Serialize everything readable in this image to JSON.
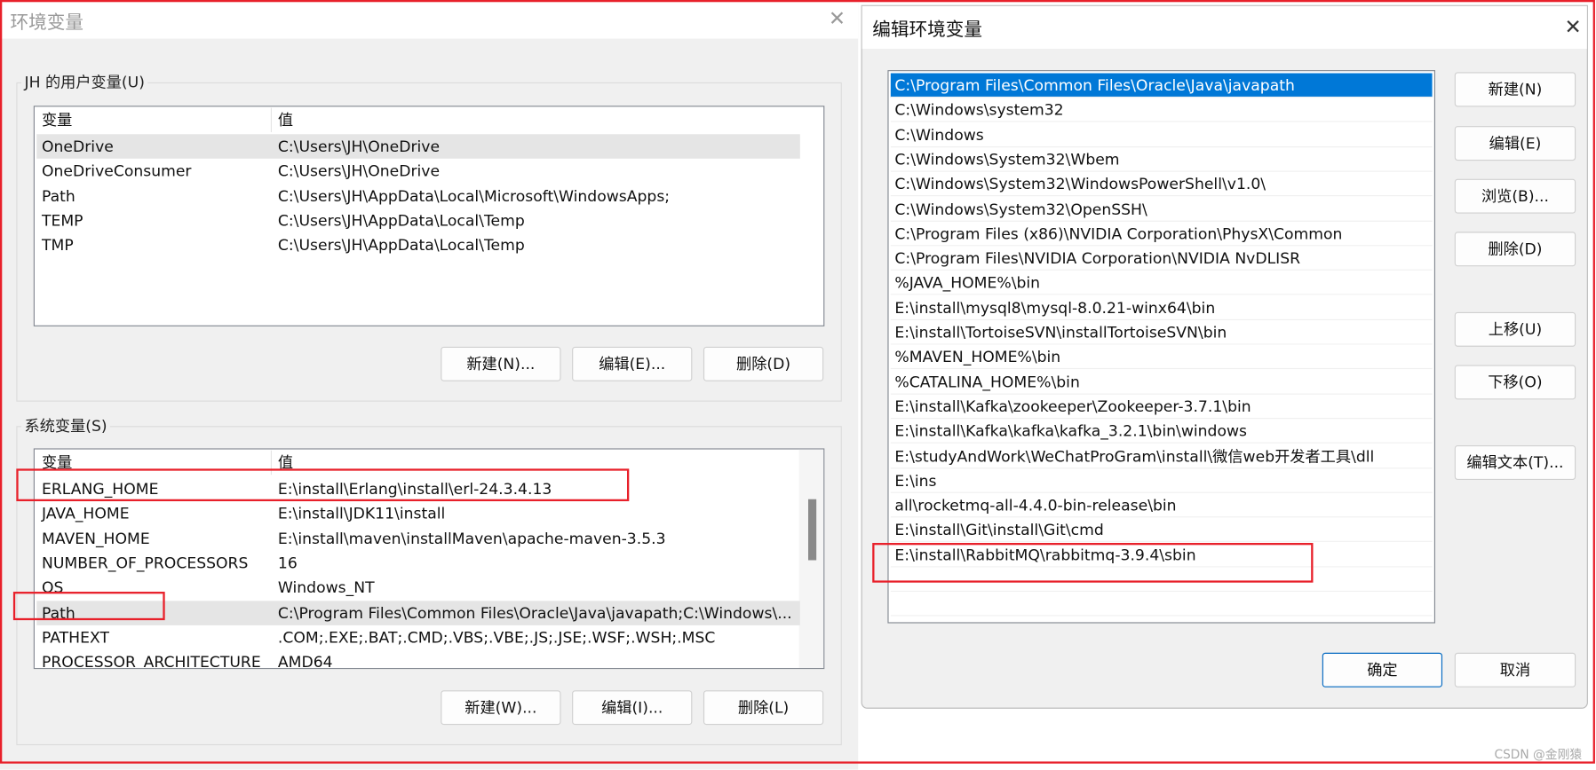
{
  "env_dialog": {
    "title": "环境变量",
    "user_group": {
      "label": "JH 的用户变量(U)",
      "headers": [
        "变量",
        "值"
      ],
      "rows": [
        [
          "OneDrive",
          "C:\\Users\\JH\\OneDrive"
        ],
        [
          "OneDriveConsumer",
          "C:\\Users\\JH\\OneDrive"
        ],
        [
          "Path",
          "C:\\Users\\JH\\AppData\\Local\\Microsoft\\WindowsApps;"
        ],
        [
          "TEMP",
          "C:\\Users\\JH\\AppData\\Local\\Temp"
        ],
        [
          "TMP",
          "C:\\Users\\JH\\AppData\\Local\\Temp"
        ]
      ],
      "buttons": [
        "新建(N)...",
        "编辑(E)...",
        "删除(D)"
      ]
    },
    "system_group": {
      "label": "系统变量(S)",
      "headers": [
        "变量",
        "值"
      ],
      "rows": [
        [
          "ERLANG_HOME",
          "E:\\install\\Erlang\\install\\erl-24.3.4.13"
        ],
        [
          "JAVA_HOME",
          "E:\\install\\JDK11\\install"
        ],
        [
          "MAVEN_HOME",
          "E:\\install\\maven\\installMaven\\apache-maven-3.5.3"
        ],
        [
          "NUMBER_OF_PROCESSORS",
          "16"
        ],
        [
          "OS",
          "Windows_NT"
        ],
        [
          "Path",
          "C:\\Program Files\\Common Files\\Oracle\\Java\\javapath;C:\\Windows\\..."
        ],
        [
          "PATHEXT",
          ".COM;.EXE;.BAT;.CMD;.VBS;.VBE;.JS;.JSE;.WSF;.WSH;.MSC"
        ],
        [
          "PROCESSOR_ARCHITECTURE",
          "AMD64"
        ]
      ],
      "buttons": [
        "新建(W)...",
        "编辑(I)...",
        "删除(L)"
      ]
    }
  },
  "edit_dialog": {
    "title": "编辑环境变量",
    "paths": [
      "C:\\Program Files\\Common Files\\Oracle\\Java\\javapath",
      "C:\\Windows\\system32",
      "C:\\Windows",
      "C:\\Windows\\System32\\Wbem",
      "C:\\Windows\\System32\\WindowsPowerShell\\v1.0\\",
      "C:\\Windows\\System32\\OpenSSH\\",
      "C:\\Program Files (x86)\\NVIDIA Corporation\\PhysX\\Common",
      "C:\\Program Files\\NVIDIA Corporation\\NVIDIA NvDLISR",
      "%JAVA_HOME%\\bin",
      "E:\\install\\mysql8\\mysql-8.0.21-winx64\\bin",
      "E:\\install\\TortoiseSVN\\installTortoiseSVN\\bin",
      "%MAVEN_HOME%\\bin",
      "%CATALINA_HOME%\\bin",
      "E:\\install\\Kafka\\zookeeper\\Zookeeper-3.7.1\\bin",
      "E:\\install\\Kafka\\kafka\\kafka_3.2.1\\bin\\windows",
      "E:\\studyAndWork\\WeChatProGram\\install\\微信web开发者工具\\dll",
      "E:\\ins",
      "all\\rocketmq-all-4.4.0-bin-release\\bin",
      "E:\\install\\Git\\install\\Git\\cmd",
      "E:\\install\\RabbitMQ\\rabbitmq-3.9.4\\sbin"
    ],
    "buttons": {
      "new": "新建(N)",
      "edit": "编辑(E)",
      "browse": "浏览(B)...",
      "delete": "删除(D)",
      "up": "上移(U)",
      "down": "下移(O)",
      "edit_text": "编辑文本(T)...",
      "ok": "确定",
      "cancel": "取消"
    }
  },
  "watermark": "CSDN @金刚猿",
  "colors": {
    "selection": "#0078d7",
    "annotation": "#e8202a",
    "dialog_bg": "#f0f0f0"
  }
}
